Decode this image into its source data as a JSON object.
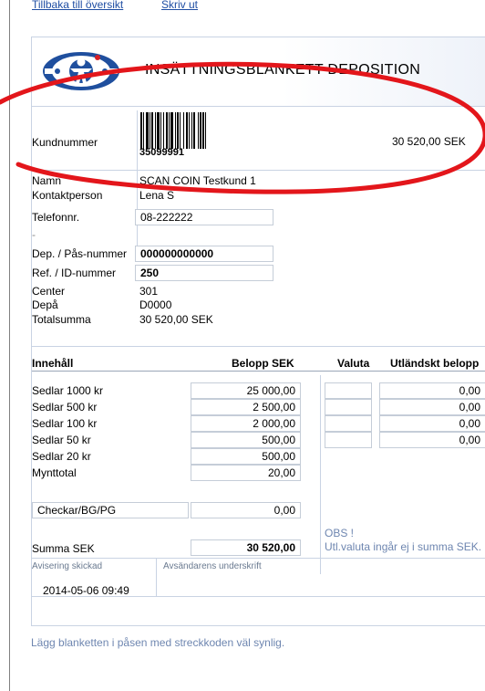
{
  "nav": {
    "back_label": "Tillbaka till översikt",
    "print_label": "Skriv ut"
  },
  "header": {
    "title": "INSÄTTNINGSBLANKETT DEPOSITION"
  },
  "customer": {
    "number_label": "Kundnummer",
    "barcode_number": "35099991",
    "amount": "30 520,00 SEK",
    "name_label": "Namn",
    "name_value": "SCAN COIN Testkund 1",
    "contact_label": "Kontaktperson",
    "contact_value": "Lena S",
    "phone_label": "Telefonnr.",
    "phone_value": "08-222222",
    "dash": "-"
  },
  "deposit": {
    "dep_label": "Dep. / Pås-nummer",
    "dep_value": "000000000000",
    "ref_label": "Ref. / ID-nummer",
    "ref_value": "250",
    "center_label": "Center",
    "center_value": "301",
    "depa_label": "Depå",
    "depa_value": "D0000",
    "total_label": "Totalsumma",
    "total_value": "30 520,00 SEK"
  },
  "content_table": {
    "headers": {
      "content": "Innehåll",
      "amount": "Belopp SEK",
      "currency": "Valuta",
      "foreign": "Utländskt belopp"
    },
    "rows": [
      {
        "label": "Sedlar 1000 kr",
        "amount": "25 000,00",
        "foreign": "0,00"
      },
      {
        "label": "Sedlar 500 kr",
        "amount": "2 500,00",
        "foreign": "0,00"
      },
      {
        "label": "Sedlar 100 kr",
        "amount": "2 000,00",
        "foreign": "0,00"
      },
      {
        "label": "Sedlar 50 kr",
        "amount": "500,00",
        "foreign": "0,00"
      },
      {
        "label": "Sedlar 20 kr",
        "amount": "500,00"
      },
      {
        "label": "Mynttotal",
        "amount": "20,00"
      }
    ],
    "check_label": "Checkar/BG/PG",
    "check_amount": "0,00",
    "sum_label": "Summa SEK",
    "sum_value": "30 520,00",
    "obs_title": "OBS !",
    "obs_text": "Utl.valuta ingår ej i summa SEK."
  },
  "signature": {
    "notice_label": "Avisering skickad",
    "notice_value": "2014-05-06 09:49",
    "sender_label": "Avsändarens underskrift"
  },
  "footer": {
    "note": "Lägg blanketten i påsen med streckkoden väl synlig."
  },
  "annotation": {
    "color": "#e3161b"
  }
}
